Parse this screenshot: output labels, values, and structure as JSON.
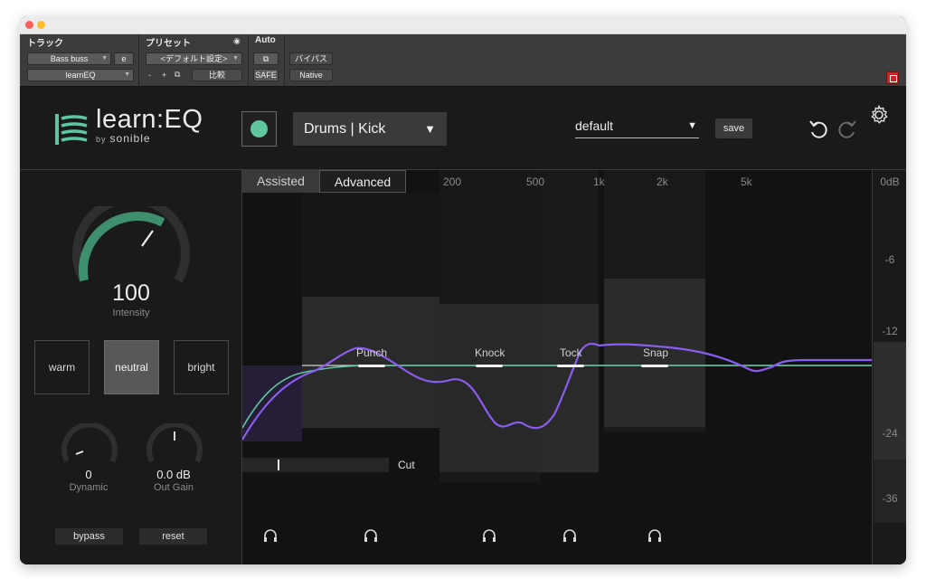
{
  "host": {
    "headers": {
      "track": "トラック",
      "preset": "プリセット",
      "auto": "Auto"
    },
    "track_name": "Bass buss",
    "track_suffix": "e",
    "insert_name": "learnEQ",
    "preset_value": "<デフォルト設定>",
    "minus": "-",
    "plus": "+",
    "compare": "比較",
    "safe": "SAFE",
    "bypass": "バイパス",
    "native": "Native"
  },
  "plugin": {
    "logo_text": "learn:EQ",
    "logo_by": "by",
    "logo_brand": "sonible",
    "preset_category": "Drums | Kick",
    "preset_name": "default",
    "save_label": "save",
    "colors": {
      "accent": "#5fc6a0",
      "curve": "#8a5cf0",
      "target_curve": "#5fc6a0"
    }
  },
  "left": {
    "intensity_value": "100",
    "intensity_label": "Intensity",
    "intensity_level": 1.0,
    "tone": {
      "warm": "warm",
      "neutral": "neutral",
      "bright": "bright",
      "selected": "neutral"
    },
    "dynamic_value": "0",
    "dynamic_label": "Dynamic",
    "outgain_value": "0.0 dB",
    "outgain_label": "Out Gain",
    "bypass_label": "bypass",
    "reset_label": "reset"
  },
  "eq": {
    "tabs": {
      "assisted": "Assisted",
      "advanced": "Advanced",
      "selected": "Advanced"
    },
    "freq_labels": [
      "200",
      "500",
      "1k",
      "2k",
      "5k"
    ],
    "bands": {
      "punch": "Punch",
      "knock": "Knock",
      "tock": "Tock",
      "snap": "Snap"
    },
    "cut_label": "Cut"
  },
  "meter": {
    "labels": [
      "0dB",
      "-6",
      "-12",
      "-24",
      "-36"
    ]
  }
}
